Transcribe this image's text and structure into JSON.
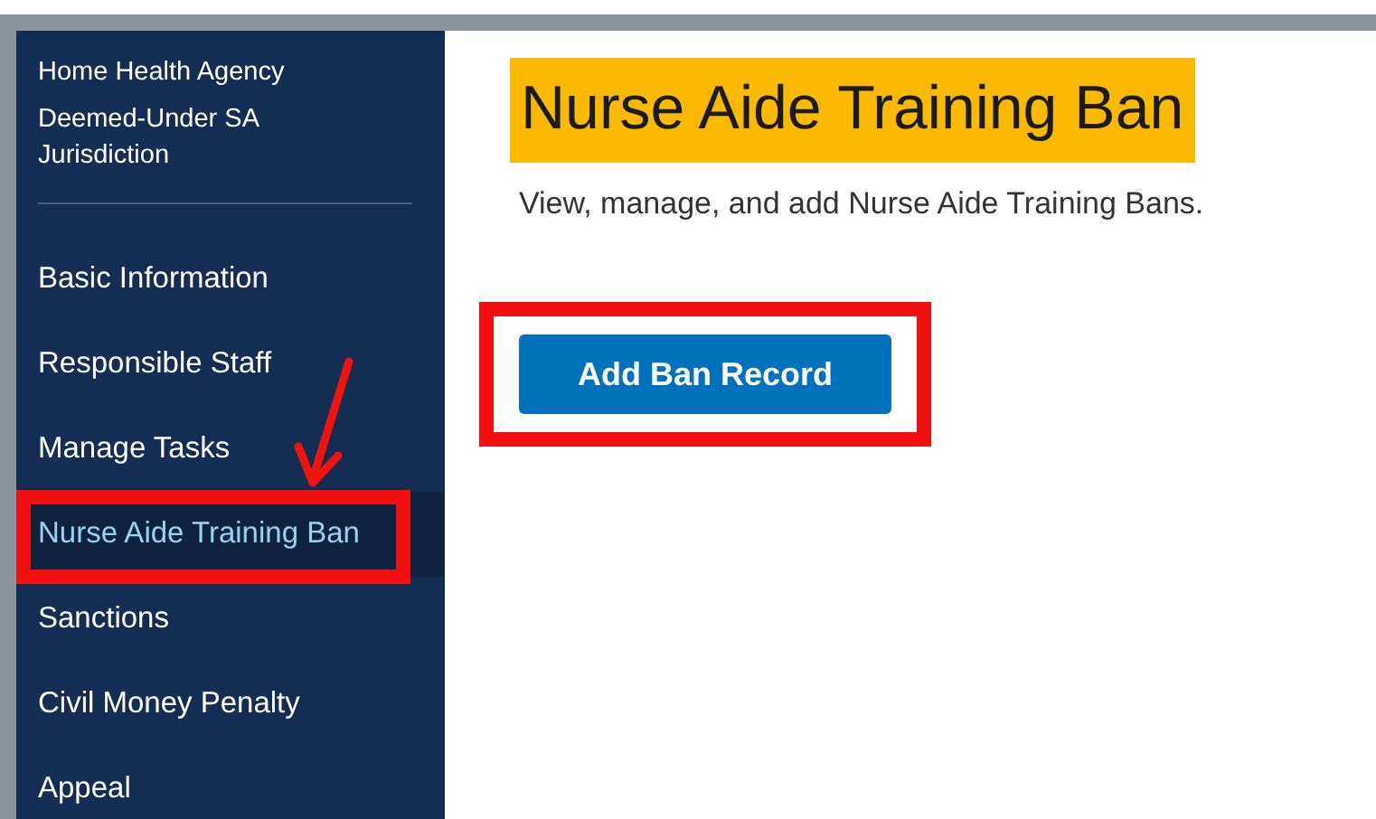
{
  "sidebar": {
    "header": [
      "Home Health Agency",
      "Deemed-Under SA Jurisdiction"
    ],
    "items": [
      {
        "label": "Basic Information",
        "selected": false,
        "annotated": false
      },
      {
        "label": "Responsible Staff",
        "selected": false,
        "annotated": false
      },
      {
        "label": "Manage Tasks",
        "selected": false,
        "annotated": false
      },
      {
        "label": "Nurse Aide Training Ban",
        "selected": true,
        "annotated": true
      },
      {
        "label": "Sanctions",
        "selected": false,
        "annotated": false
      },
      {
        "label": "Civil Money Penalty",
        "selected": false,
        "annotated": false
      },
      {
        "label": "Appeal",
        "selected": false,
        "annotated": false
      }
    ],
    "pointer_arrow": true
  },
  "main": {
    "title": "Nurse Aide Training Ban",
    "title_highlighted": true,
    "description": "View, manage, and add Nurse Aide Training Bans.",
    "button": {
      "label": "Add Ban Record",
      "annotated": true
    }
  }
}
